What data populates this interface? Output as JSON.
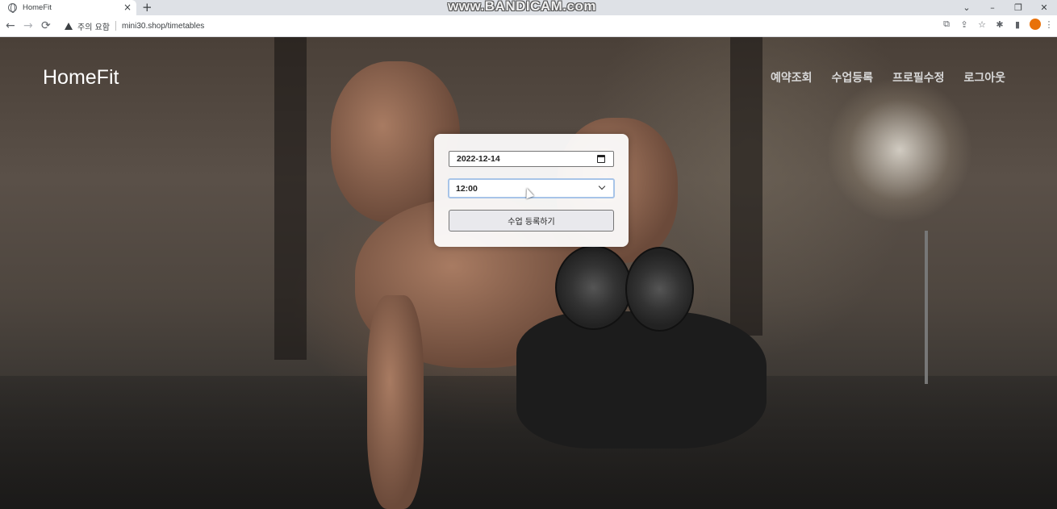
{
  "browser": {
    "tab_title": "HomeFit",
    "tab_close": "×",
    "new_tab": "+",
    "watermark": "www.BANDICAM.com",
    "window_controls": {
      "chevron": "⌄",
      "minimize": "–",
      "restore": "❐",
      "close": "✕"
    },
    "nav": {
      "back": "←",
      "forward": "→",
      "reload": "⟳"
    },
    "security_warning": "주의 요함",
    "url": "mini30.shop/timetables",
    "toolbar_icons": {
      "translate": "⧉",
      "share": "⇪",
      "bookmark": "☆",
      "extensions": "✱",
      "sidepanel": "▮",
      "menu": "⋮"
    }
  },
  "page": {
    "brand": "HomeFit",
    "nav_items": [
      "예약조회",
      "수업등록",
      "프로필수정",
      "로그아웃"
    ]
  },
  "form": {
    "date_value": "2022-12-14",
    "time_value": "12:00",
    "submit_label": "수업 등록하기"
  }
}
